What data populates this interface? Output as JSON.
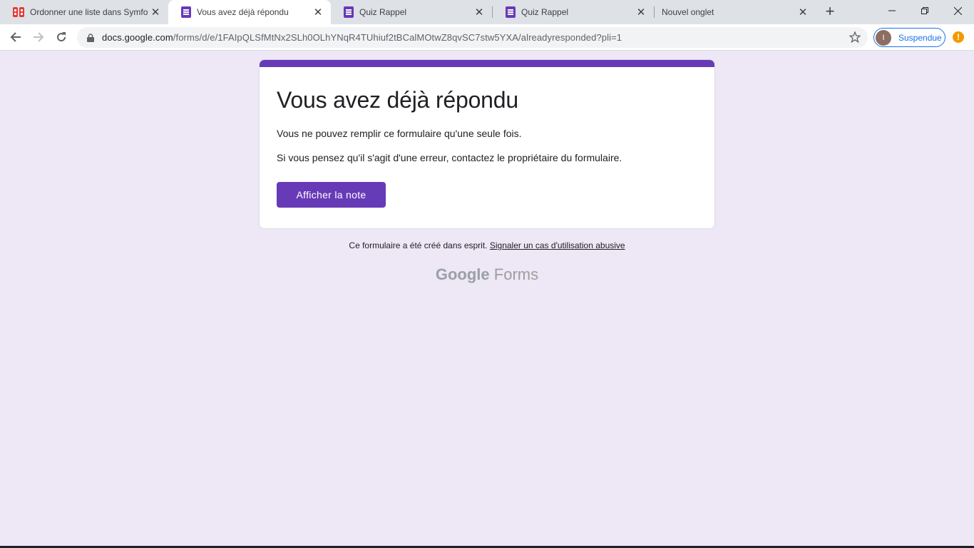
{
  "browser": {
    "tabs": [
      {
        "title": "Ordonner une liste dans Symfo",
        "favicon": "symfony-icon",
        "active": false
      },
      {
        "title": "Vous avez déjà répondu",
        "favicon": "google-forms-icon",
        "active": true
      },
      {
        "title": "Quiz Rappel",
        "favicon": "google-forms-icon",
        "active": false
      },
      {
        "title": "Quiz Rappel",
        "favicon": "google-forms-icon",
        "active": false
      },
      {
        "title": "Nouvel onglet",
        "favicon": "none",
        "active": false
      }
    ],
    "url_host": "docs.google.com",
    "url_path": "/forms/d/e/1FAIpQLSfMtNx2SLh0OLhYNqR4TUhiuf2tBCalMOtwZ8qvSC7stw5YXA/alreadyresponded?pli=1",
    "profile_initial": "I",
    "profile_label": "Suspendue",
    "accent_color": "#1a73e8",
    "alert_color": "#f29900"
  },
  "page": {
    "title": "Vous avez déjà répondu",
    "message_once": "Vous ne pouvez remplir ce formulaire qu'une seule fois.",
    "message_error": "Si vous pensez qu'il s'agit d'une erreur, contactez le propriétaire du formulaire.",
    "button_label": "Afficher la note",
    "footer_text": "Ce formulaire a été créé dans esprit.",
    "report_link": "Signaler un cas d'utilisation abusive",
    "brand_google": "Google",
    "brand_forms": "Forms",
    "theme_color": "#673ab7",
    "background_color": "#ede7f6"
  }
}
